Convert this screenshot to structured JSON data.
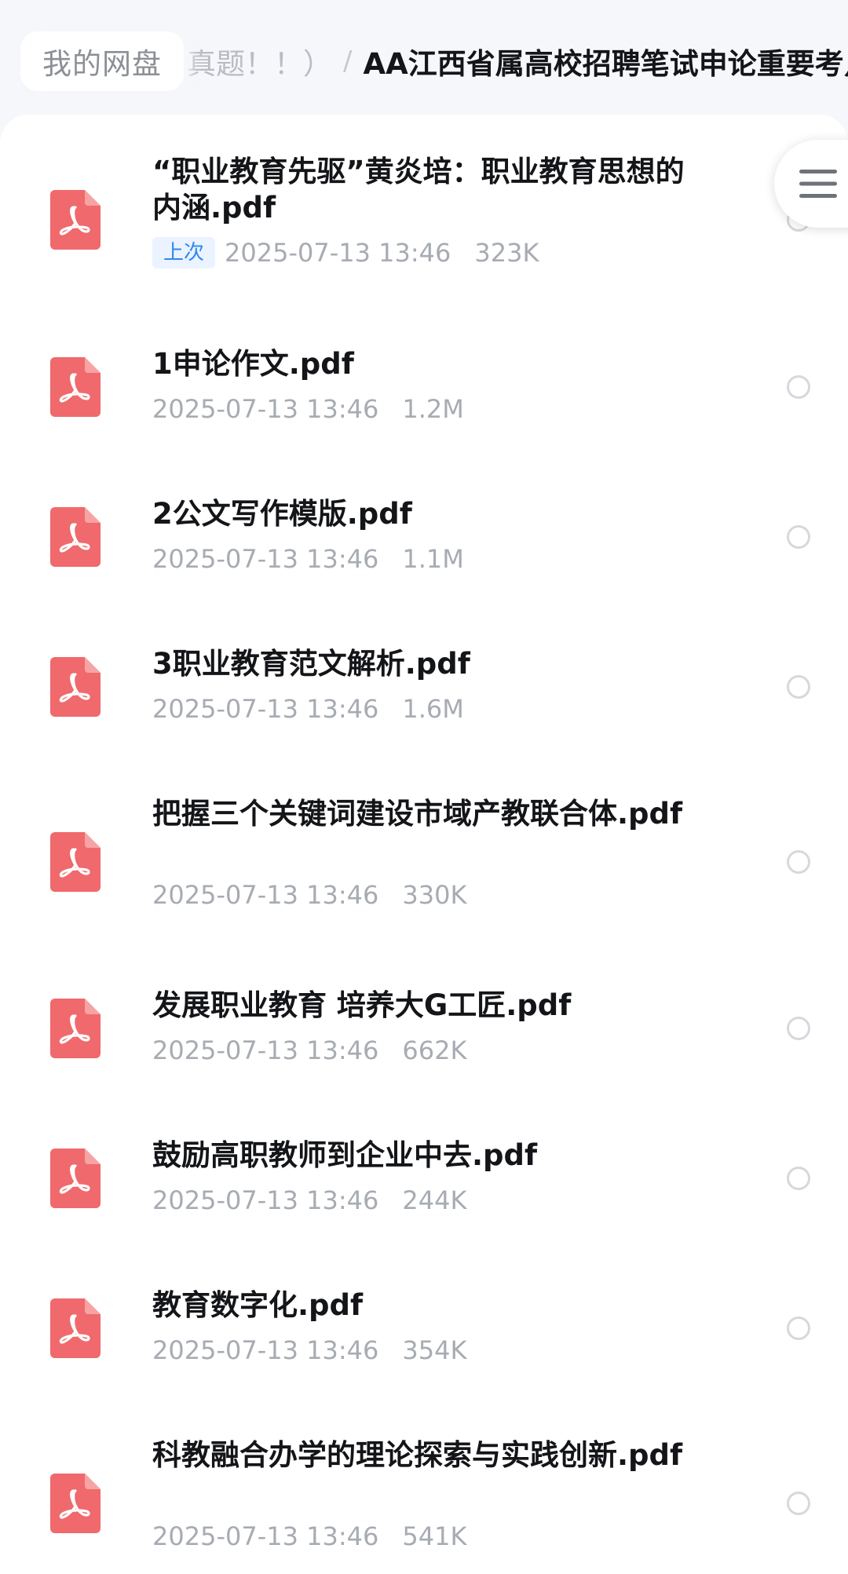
{
  "breadcrumb": {
    "home": "我的网盘",
    "previous": "真题！！）",
    "separator": "/",
    "current": "AA江西省属高校招聘笔试申论重要考点"
  },
  "icons": {
    "file_type": "pdf-icon",
    "select": "radio-circle-icon",
    "menu": "hamburger-menu-icon"
  },
  "colors": {
    "pdf_icon": "#f0696c",
    "badge_text": "#2f87f2",
    "badge_bg": "#eaf3ff",
    "meta_text": "#a7abb2",
    "title_text": "#141518"
  },
  "files": [
    {
      "name": "“职业教育先驱”黄炎培：职业教育思想的内涵.pdf",
      "badge": "上次",
      "date": "2025-07-13 13:46",
      "size": "323K"
    },
    {
      "name": "1申论作文.pdf",
      "badge": "",
      "date": "2025-07-13 13:46",
      "size": "1.2M"
    },
    {
      "name": "2公文写作模版.pdf",
      "badge": "",
      "date": "2025-07-13 13:46",
      "size": "1.1M"
    },
    {
      "name": "3职业教育范文解析.pdf",
      "badge": "",
      "date": "2025-07-13 13:46",
      "size": "1.6M"
    },
    {
      "name": "把握三个关键词建设市域产教联合体.pdf",
      "badge": "",
      "date": "2025-07-13 13:46",
      "size": "330K"
    },
    {
      "name": "发展职业教育 培养大G工匠.pdf",
      "badge": "",
      "date": "2025-07-13 13:46",
      "size": "662K"
    },
    {
      "name": "鼓励高职教师到企业中去.pdf",
      "badge": "",
      "date": "2025-07-13 13:46",
      "size": "244K"
    },
    {
      "name": "教育数字化.pdf",
      "badge": "",
      "date": "2025-07-13 13:46",
      "size": "354K"
    },
    {
      "name": "科教融合办学的理论探索与实践创新.pdf",
      "badge": "",
      "date": "2025-07-13 13:46",
      "size": "541K"
    }
  ]
}
